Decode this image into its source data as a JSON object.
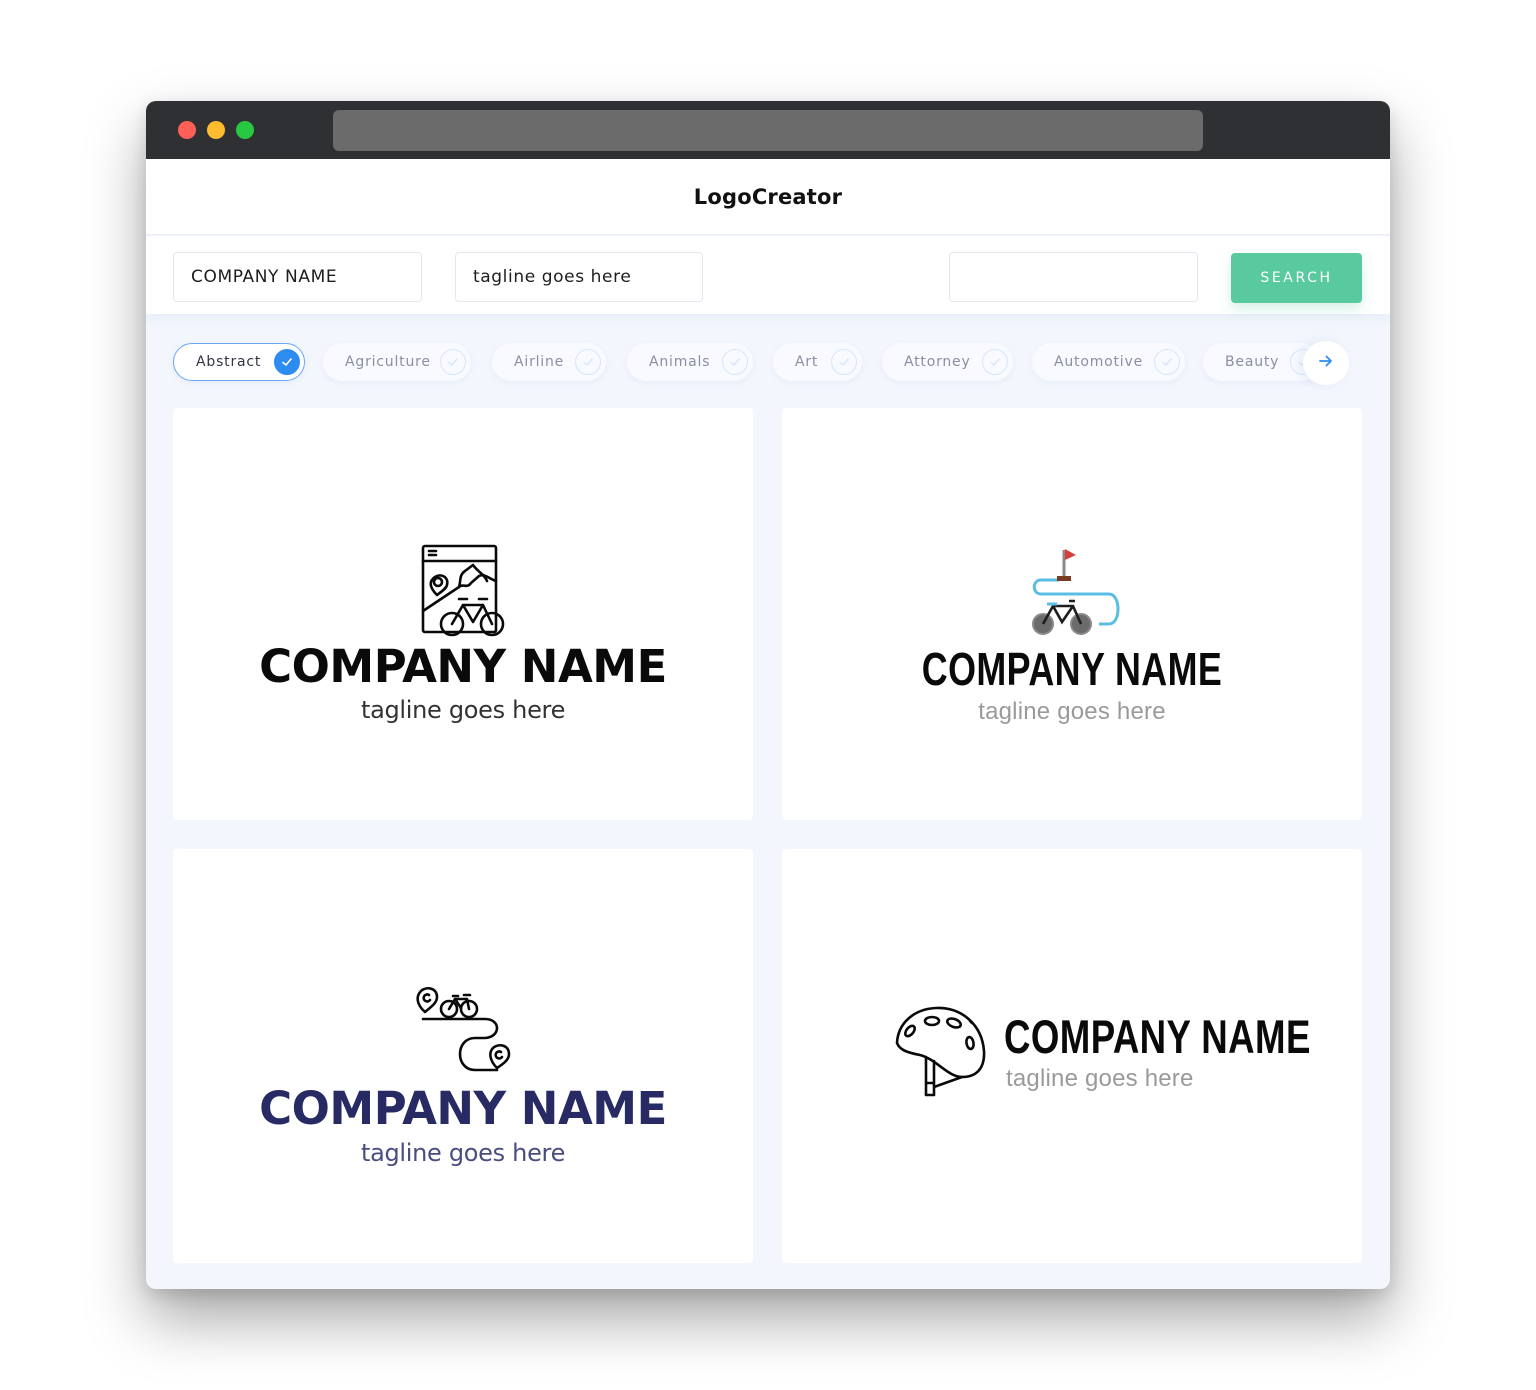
{
  "window": {
    "traffic_lights": [
      "close",
      "minimize",
      "maximize"
    ],
    "url": ""
  },
  "header": {
    "brand": "LogoCreator"
  },
  "search": {
    "company_value": "COMPANY NAME",
    "tagline_value": "tagline goes here",
    "keyword_value": "",
    "button_label": "SEARCH",
    "button_color": "#59c99e"
  },
  "categories": {
    "items": [
      {
        "label": "Abstract",
        "selected": true
      },
      {
        "label": "Agriculture",
        "selected": false
      },
      {
        "label": "Airline",
        "selected": false
      },
      {
        "label": "Animals",
        "selected": false
      },
      {
        "label": "Art",
        "selected": false
      },
      {
        "label": "Attorney",
        "selected": false
      },
      {
        "label": "Automotive",
        "selected": false
      },
      {
        "label": "Beauty",
        "selected": false
      }
    ],
    "next_icon": "arrow-right-icon",
    "accent_color": "#2d8cf0"
  },
  "logos": [
    {
      "icon": "map-bicycle-icon",
      "company": "COMPANY NAME",
      "tagline": "tagline goes here",
      "color": "#0a0a0a"
    },
    {
      "icon": "bicycle-route-flag-icon",
      "company": "COMPANY NAME",
      "tagline": "tagline goes here",
      "color": "#0a0a0a"
    },
    {
      "icon": "bicycle-path-pins-icon",
      "company": "COMPANY NAME",
      "tagline": "tagline goes here",
      "color": "#282a63"
    },
    {
      "icon": "bike-helmet-icon",
      "company": "COMPANY NAME",
      "tagline": "tagline goes here",
      "color": "#0a0a0a"
    }
  ]
}
